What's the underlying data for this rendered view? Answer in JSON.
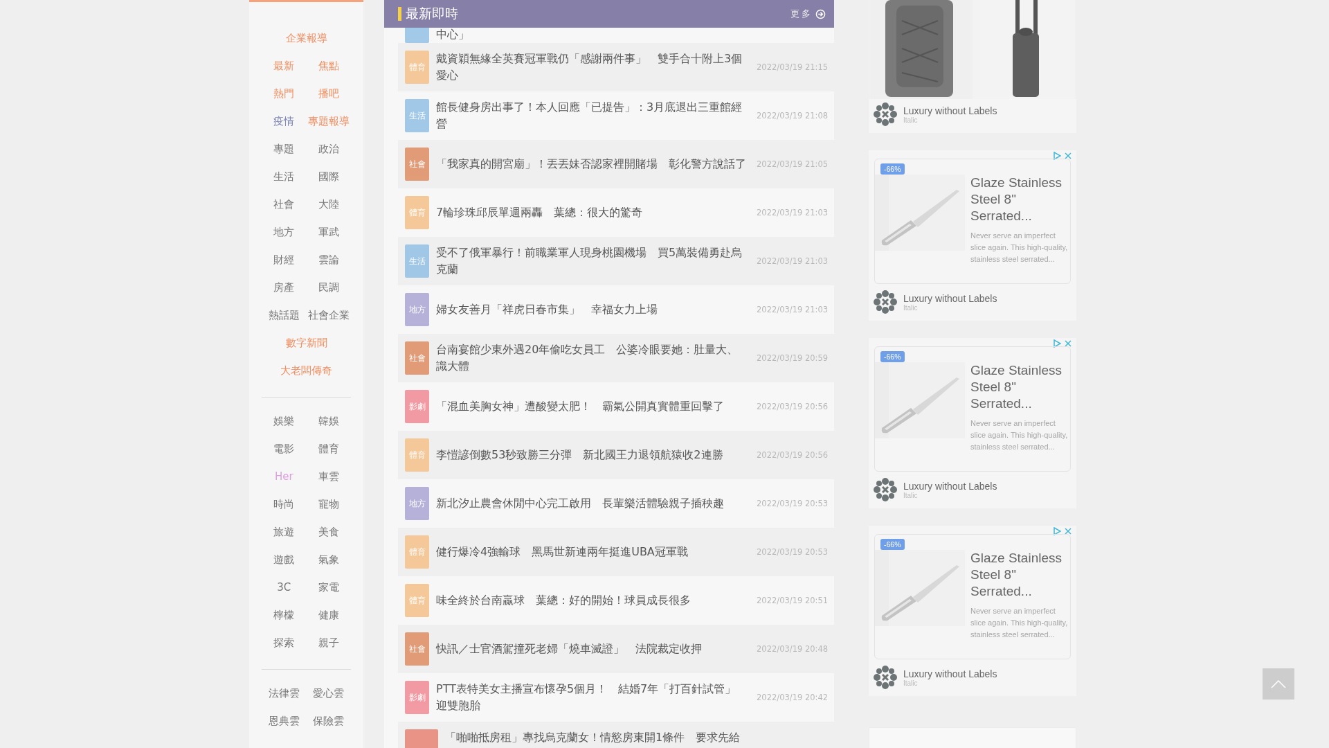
{
  "sidebar": {
    "sections": [
      [
        {
          "label": "企業報導",
          "kind": "full",
          "color": "#ee8d60"
        },
        {
          "label": "最新",
          "kind": "half",
          "color": "#ee8d60"
        },
        {
          "label": "焦點",
          "kind": "half",
          "color": "#ee8d60"
        },
        {
          "label": "熱門",
          "kind": "half",
          "color": "#ee8d60"
        },
        {
          "label": "播吧",
          "kind": "half",
          "color": "#ee8d60"
        },
        {
          "label": "疫情",
          "kind": "half",
          "color": "#7b80b3"
        },
        {
          "label": "專題報導",
          "kind": "half",
          "color": "#ee8d60"
        },
        {
          "label": "專題",
          "kind": "half",
          "color": "#777777"
        },
        {
          "label": "政治",
          "kind": "half",
          "color": "#777777"
        },
        {
          "label": "生活",
          "kind": "half",
          "color": "#777777"
        },
        {
          "label": "國際",
          "kind": "half",
          "color": "#777777"
        },
        {
          "label": "社會",
          "kind": "half",
          "color": "#777777"
        },
        {
          "label": "大陸",
          "kind": "half",
          "color": "#777777"
        },
        {
          "label": "地方",
          "kind": "half",
          "color": "#777777"
        },
        {
          "label": "軍武",
          "kind": "half",
          "color": "#777777"
        },
        {
          "label": "財經",
          "kind": "half",
          "color": "#777777"
        },
        {
          "label": "雲論",
          "kind": "half",
          "color": "#777777"
        },
        {
          "label": "房產",
          "kind": "half",
          "color": "#777777"
        },
        {
          "label": "民調",
          "kind": "half",
          "color": "#777777"
        },
        {
          "label": "熱話題",
          "kind": "half",
          "color": "#777777"
        },
        {
          "label": "社會企業",
          "kind": "half",
          "color": "#777777"
        },
        {
          "label": "數字新聞",
          "kind": "full",
          "color": "#ee8d60"
        },
        {
          "label": "大老闆傳奇",
          "kind": "full",
          "color": "#ee8d60"
        }
      ],
      [
        {
          "label": "娛樂",
          "kind": "half",
          "color": "#777777"
        },
        {
          "label": "韓娛",
          "kind": "half",
          "color": "#777777"
        },
        {
          "label": "電影",
          "kind": "half",
          "color": "#777777"
        },
        {
          "label": "體育",
          "kind": "half",
          "color": "#777777"
        },
        {
          "label": "Her",
          "kind": "half",
          "color": "#dca0e0"
        },
        {
          "label": "車雲",
          "kind": "half",
          "color": "#777777"
        },
        {
          "label": "時尚",
          "kind": "half",
          "color": "#777777"
        },
        {
          "label": "寵物",
          "kind": "half",
          "color": "#777777"
        },
        {
          "label": "旅遊",
          "kind": "half",
          "color": "#777777"
        },
        {
          "label": "美食",
          "kind": "half",
          "color": "#777777"
        },
        {
          "label": "遊戲",
          "kind": "half",
          "color": "#777777"
        },
        {
          "label": "氣象",
          "kind": "half",
          "color": "#777777"
        },
        {
          "label": "3C",
          "kind": "half",
          "color": "#777777"
        },
        {
          "label": "家電",
          "kind": "half",
          "color": "#777777"
        },
        {
          "label": "檸檬",
          "kind": "half",
          "color": "#777777"
        },
        {
          "label": "健康",
          "kind": "half",
          "color": "#777777"
        },
        {
          "label": "探索",
          "kind": "half",
          "color": "#777777"
        },
        {
          "label": "親子",
          "kind": "half",
          "color": "#777777"
        }
      ],
      [
        {
          "label": "法律雲",
          "kind": "half",
          "color": "#777777"
        },
        {
          "label": "愛心雲",
          "kind": "half",
          "color": "#777777"
        },
        {
          "label": "恩典雲",
          "kind": "half",
          "color": "#777777"
        },
        {
          "label": "保險雲",
          "kind": "half",
          "color": "#777777"
        }
      ]
    ]
  },
  "news": {
    "title": "最新即時",
    "more": "更多",
    "items": [
      {
        "kind": "partial",
        "color": "#99c3e6",
        "title": "中心」"
      },
      {
        "kind": "story",
        "category": "體育",
        "color": "#f5c48f",
        "title": "戴資穎無緣全英賽冠軍戰仍「感謝兩件事」　雙手合十附上3個愛心",
        "time": "2022/03/19 21:15"
      },
      {
        "kind": "story",
        "category": "生活",
        "color": "#99c3e6",
        "title": "館長健身房出事了！本人回應「已提告」：3月底退出三重館經營",
        "time": "2022/03/19 21:08"
      },
      {
        "kind": "story",
        "category": "社會",
        "color": "#e0926a",
        "title": "「我家真的開宮廟」！丟丟妹否認家裡開賭場　彰化警方說話了",
        "time": "2022/03/19 21:05"
      },
      {
        "kind": "story",
        "category": "體育",
        "color": "#f5c48f",
        "title": "7輪珍珠邱辰單週兩轟　葉總：很大的驚奇",
        "time": "2022/03/19 21:03"
      },
      {
        "kind": "story",
        "category": "生活",
        "color": "#99c3e6",
        "title": "受不了俄軍暴行！前職業軍人現身桃園機場　買5萬裝備勇赴烏克蘭",
        "time": "2022/03/19 21:03"
      },
      {
        "kind": "story",
        "category": "地方",
        "color": "#aeaad6",
        "title": "婦女友善月「祥虎日春市集」　幸福女力上場",
        "time": "2022/03/19 21:03"
      },
      {
        "kind": "story",
        "category": "社會",
        "color": "#e0926a",
        "title": "台南宴館少東外遇20年偷吃女員工　公婆冷眼要她：肚量大、識大體",
        "time": "2022/03/19 20:59"
      },
      {
        "kind": "story",
        "category": "影劇",
        "color": "#f2909a",
        "title": "「混血美胸女神」遭酸變太肥！　霸氣公開真實體重回擊了",
        "time": "2022/03/19 20:56"
      },
      {
        "kind": "story",
        "category": "體育",
        "color": "#f5c48f",
        "title": "李愷諺倒數53秒致勝三分彈　新北國王力退領航猿收2連勝",
        "time": "2022/03/19 20:56"
      },
      {
        "kind": "story",
        "category": "地方",
        "color": "#aeaad6",
        "title": "新北汐止農會休閒中心完工啟用　長輩樂活體驗親子插秧趣",
        "time": "2022/03/19 20:53"
      },
      {
        "kind": "story",
        "category": "體育",
        "color": "#f5c48f",
        "title": "健行爆冷4強輸球　黑馬世新連兩年挺進UBA冠軍戰",
        "time": "2022/03/19 20:53"
      },
      {
        "kind": "story",
        "category": "體育",
        "color": "#f5c48f",
        "title": "味全終於台南贏球　葉總：好的開始！球員成長很多",
        "time": "2022/03/19 20:51"
      },
      {
        "kind": "story",
        "category": "社會",
        "color": "#e0926a",
        "title": "快訊／士官酒駕撞死老婦「燒車滅證」　法院裁定收押",
        "time": "2022/03/19 20:48"
      },
      {
        "kind": "story",
        "category": "影劇",
        "color": "#f2909a",
        "title": "PTT表特美女主播宣布懷孕5個月！　結婚7年「打百針試管」迎雙胞胎",
        "time": "2022/03/19 20:42"
      },
      {
        "kind": "cut",
        "color": "#e8877a",
        "title": "「啪啪抵房租」專找烏克蘭女！情慾房東開1條件　要求先給"
      }
    ]
  },
  "ads": {
    "featured": {
      "brand": "Luxury without Labels",
      "sub": "Italic"
    },
    "cards": [
      {
        "discount": "-66%",
        "title": "Glaze Stainless Steel 8\" Serrated...",
        "description": "Never serve an imperfect slice again. This high-quality, stainless steel serrated...",
        "brand": "Luxury without Labels",
        "sub": "Italic"
      },
      {
        "discount": "-66%",
        "title": "Glaze Stainless Steel 8\" Serrated...",
        "description": "Never serve an imperfect slice again. This high-quality, stainless steel serrated...",
        "brand": "Luxury without Labels",
        "sub": "Italic"
      },
      {
        "discount": "-66%",
        "title": "Glaze Stainless Steel 8\" Serrated...",
        "description": "Never serve an imperfect slice again. This high-quality, stainless steel serrated...",
        "brand": "Luxury without Labels",
        "sub": "Italic"
      }
    ]
  }
}
